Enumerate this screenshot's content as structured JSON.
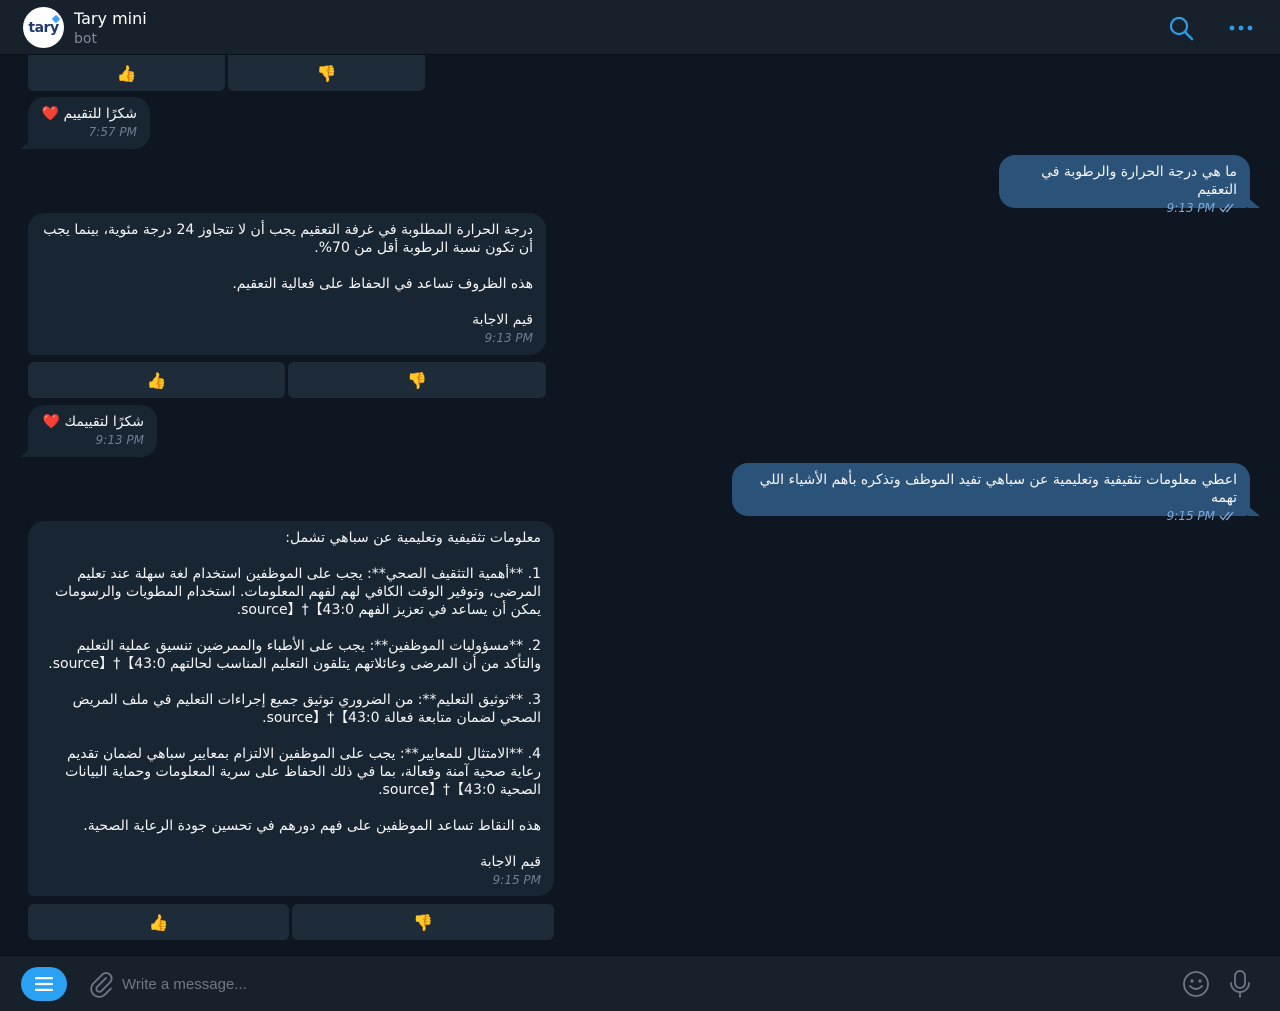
{
  "header": {
    "title": "Tary mini",
    "subtitle": "bot",
    "avatar_text": "tary"
  },
  "messages": [
    {
      "direction": "in",
      "text": "شكرًا للتقييم ❤️",
      "time": "7:57 PM"
    },
    {
      "direction": "out",
      "text": "ما هي درجة الحرارة والرطوبة في التعقيم",
      "time": "9:13 PM"
    },
    {
      "direction": "in",
      "text": "درجة الحرارة المطلوبة في غرفة التعقيم يجب أن لا تتجاوز 24 درجة مئوية، بينما يجب أن تكون نسبة الرطوبة أقل من 70%.\n\nهذه الظروف تساعد في الحفاظ على فعالية التعقيم.\n\nقيم الاجابة",
      "time": "9:13 PM"
    },
    {
      "direction": "in",
      "text": "شكرًا لتقييمك ❤️",
      "time": "9:13 PM"
    },
    {
      "direction": "out",
      "text": "اعطي معلومات تثقيفية وتعليمية عن سباهي تفيد الموظف وتذكره بأهم الأشياء اللي تهمه",
      "time": "9:15 PM"
    },
    {
      "direction": "in",
      "text": "معلومات تثقيفية وتعليمية عن سباهي تشمل:\n\n1. **أهمية التثقيف الصحي**: يجب على الموظفين استخدام لغة سهلة عند تعليم المرضى، وتوفير الوقت الكافي لهم لفهم المعلومات. استخدام المطويات والرسومات يمكن أن يساعد في تعزيز الفهم 【43:0†source】.\n\n2. **مسؤوليات الموظفين**: يجب على الأطباء والممرضين تنسيق عملية التعليم والتأكد من أن المرضى وعائلاتهم يتلقون التعليم المناسب لحالتهم 【43:0†source】.\n\n3. **توثيق التعليم**: من الضروري توثيق جميع إجراءات التعليم في ملف المريض الصحي لضمان متابعة فعالة 【43:0†source】.\n\n4. **الامتثال للمعايير**: يجب على الموظفين الالتزام بمعايير سباهي لضمان تقديم رعاية صحية آمنة وفعالة، بما في ذلك الحفاظ على سرية المعلومات وحماية البيانات الصحية 【43:0†source】.\n\nهذه النقاط تساعد الموظفين على فهم دورهم في تحسين جودة الرعاية الصحية.\n\nقيم الاجابة",
      "time": "9:15 PM"
    }
  ],
  "keyboards": [
    {
      "thumbs_up": "👍",
      "thumbs_down": "👎"
    },
    {
      "thumbs_up": "👍",
      "thumbs_down": "👎"
    },
    {
      "thumbs_up": "👍",
      "thumbs_down": "👎"
    }
  ],
  "composer": {
    "placeholder": "Write a message..."
  },
  "colors": {
    "background": "#0e1621",
    "panel": "#17212b",
    "incoming_bubble": "#182533",
    "outgoing_bubble": "#2b5278",
    "accent": "#2aa1f2"
  }
}
